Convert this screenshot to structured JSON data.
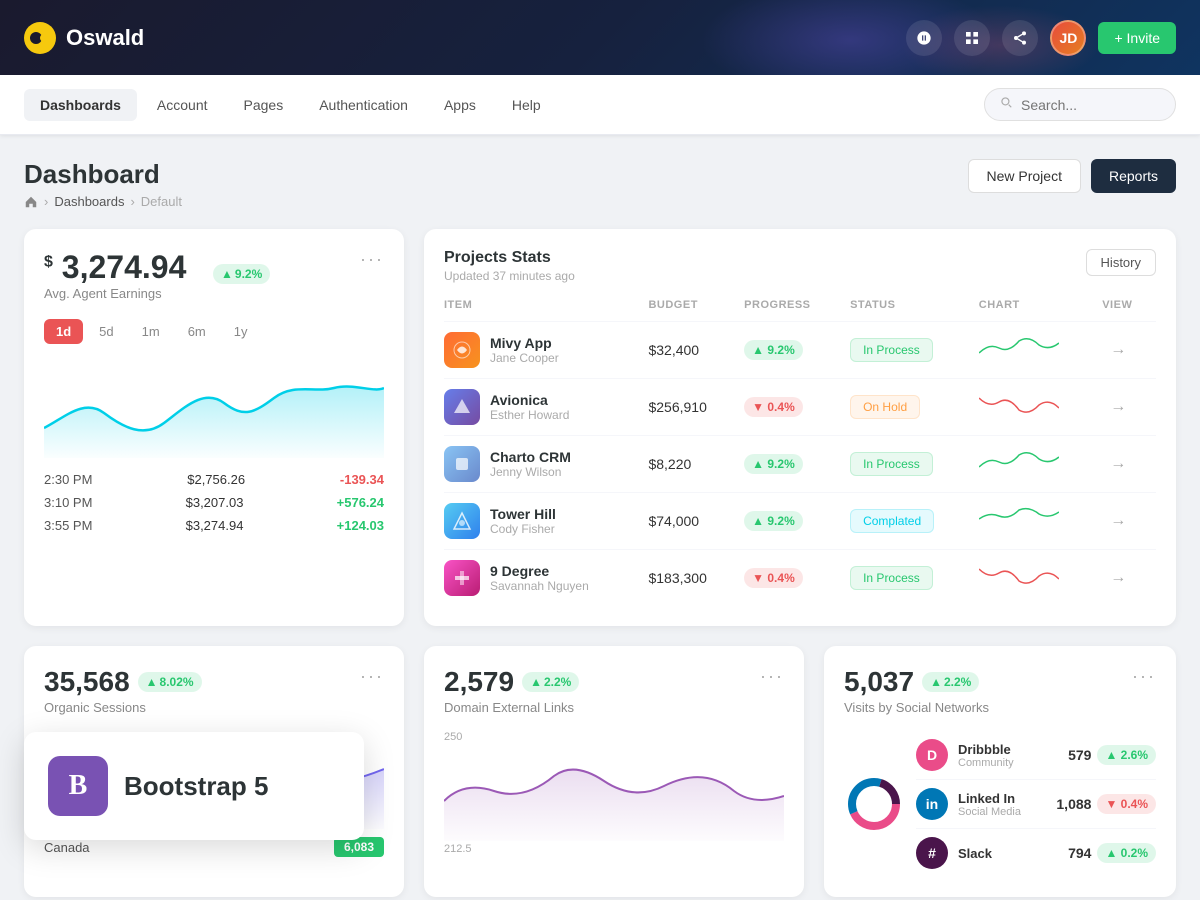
{
  "topbar": {
    "logo_text": "Oswald",
    "invite_label": "+ Invite"
  },
  "navbar": {
    "items": [
      {
        "label": "Dashboards",
        "active": true
      },
      {
        "label": "Account",
        "active": false
      },
      {
        "label": "Pages",
        "active": false
      },
      {
        "label": "Authentication",
        "active": false
      },
      {
        "label": "Apps",
        "active": false
      },
      {
        "label": "Help",
        "active": false
      }
    ],
    "search_placeholder": "Search..."
  },
  "page_header": {
    "title": "Dashboard",
    "breadcrumb": [
      "Dashboards",
      "Default"
    ],
    "btn_new_project": "New Project",
    "btn_reports": "Reports"
  },
  "earnings_card": {
    "currency": "$",
    "amount": "3,274.94",
    "badge": "9.2%",
    "label": "Avg. Agent Earnings",
    "more": "...",
    "time_filters": [
      "1d",
      "5d",
      "1m",
      "6m",
      "1y"
    ],
    "active_filter": "1d",
    "entries": [
      {
        "time": "2:30 PM",
        "amount": "$2,756.26",
        "change": "-139.34",
        "positive": false
      },
      {
        "time": "3:10 PM",
        "amount": "$3,207.03",
        "change": "+576.24",
        "positive": true
      },
      {
        "time": "3:55 PM",
        "amount": "$3,274.94",
        "change": "+124.03",
        "positive": true
      }
    ]
  },
  "projects_card": {
    "title": "Projects Stats",
    "subtitle": "Updated 37 minutes ago",
    "btn_history": "History",
    "columns": [
      "ITEM",
      "BUDGET",
      "PROGRESS",
      "STATUS",
      "CHART",
      "VIEW"
    ],
    "rows": [
      {
        "name": "Mivy App",
        "person": "Jane Cooper",
        "budget": "$32,400",
        "progress": "9.2%",
        "progress_up": true,
        "status": "In Process",
        "status_class": "in-process",
        "color": "#ff6b35"
      },
      {
        "name": "Avionica",
        "person": "Esther Howard",
        "budget": "$256,910",
        "progress": "0.4%",
        "progress_up": false,
        "status": "On Hold",
        "status_class": "on-hold",
        "color": "#ff9f43"
      },
      {
        "name": "Charto CRM",
        "person": "Jenny Wilson",
        "budget": "$8,220",
        "progress": "9.2%",
        "progress_up": true,
        "status": "In Process",
        "status_class": "in-process",
        "color": "#7367f0"
      },
      {
        "name": "Tower Hill",
        "person": "Cody Fisher",
        "budget": "$74,000",
        "progress": "9.2%",
        "progress_up": true,
        "status": "Complated",
        "status_class": "completed",
        "color": "#28c76f"
      },
      {
        "name": "9 Degree",
        "person": "Savannah Nguyen",
        "budget": "$183,300",
        "progress": "0.4%",
        "progress_up": false,
        "status": "In Process",
        "status_class": "in-process",
        "color": "#ea5455"
      }
    ]
  },
  "sessions_card": {
    "number": "35,568",
    "badge": "8.02%",
    "label": "Organic Sessions",
    "country": "Canada",
    "country_value": "6,083"
  },
  "links_card": {
    "number": "2,579",
    "badge": "2.2%",
    "label": "Domain External Links",
    "chart_y1": "250",
    "chart_y2": "212.5"
  },
  "social_card": {
    "number": "5,037",
    "badge": "2.2%",
    "label": "Visits by Social Networks",
    "networks": [
      {
        "name": "Dribbble",
        "type": "Community",
        "count": "579",
        "badge": "2.6%",
        "positive": true,
        "color": "#ea4c89"
      },
      {
        "name": "Linked In",
        "type": "Social Media",
        "count": "1,088",
        "badge": "0.4%",
        "positive": false,
        "color": "#0077b5"
      },
      {
        "name": "Slack",
        "type": "",
        "count": "794",
        "badge": "0.2%",
        "positive": true,
        "color": "#4a154b"
      }
    ]
  },
  "bootstrap_overlay": {
    "icon": "B",
    "text": "Bootstrap 5"
  }
}
